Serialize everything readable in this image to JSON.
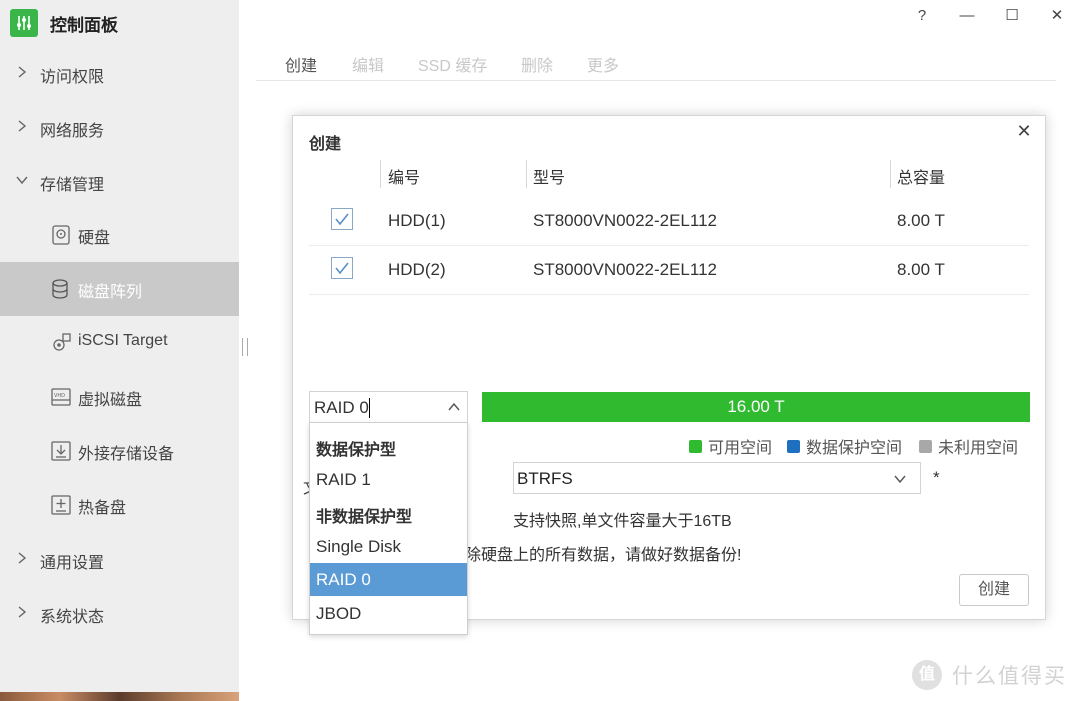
{
  "app": {
    "title": "控制面板"
  },
  "sidebar": {
    "nav": [
      {
        "label": "访问权限"
      },
      {
        "label": "网络服务"
      },
      {
        "label": "存储管理"
      },
      {
        "label": "通用设置"
      },
      {
        "label": "系统状态"
      }
    ],
    "storage_sub": [
      {
        "label": "硬盘",
        "icon": "disk-icon"
      },
      {
        "label": "磁盘阵列",
        "icon": "disk-array-icon"
      },
      {
        "label": "iSCSI Target",
        "icon": "iscsi-icon"
      },
      {
        "label": "虚拟磁盘",
        "icon": "virtual-disk-icon"
      },
      {
        "label": "外接存储设备",
        "icon": "external-storage-icon"
      },
      {
        "label": "热备盘",
        "icon": "hot-spare-icon"
      }
    ]
  },
  "window": {
    "help": "?",
    "minimize": "—",
    "maximize": "☐",
    "close": "✕"
  },
  "toolbar": {
    "create": "创建",
    "edit": "编辑",
    "ssd_cache": "SSD 缓存",
    "delete": "删除",
    "more": "更多"
  },
  "dialog": {
    "title": "创建",
    "close": "✕",
    "columns": {
      "number": "编号",
      "model": "型号",
      "capacity": "总容量"
    },
    "disks": [
      {
        "number": "HDD(1)",
        "model": "ST8000VN0022-2EL112",
        "capacity": "8.00 T",
        "checked": true
      },
      {
        "number": "HDD(2)",
        "model": "ST8000VN0022-2EL112",
        "capacity": "8.00 T",
        "checked": true
      }
    ],
    "raid_value": "RAID 0",
    "capacity_bar": "16.00 T",
    "legend": [
      {
        "label": "可用空间",
        "color": "#2fba2f"
      },
      {
        "label": "数据保护空间",
        "color": "#1f6fc0"
      },
      {
        "label": "未利用空间",
        "color": "#a8a8a8"
      }
    ],
    "fs_value": "BTRFS",
    "required_mark": "*",
    "fs_desc": "支持快照,单文件容量大于16TB",
    "warning": "除硬盘上的所有数据，请做好数据备份!",
    "partial_char": "文",
    "create_button": "创建"
  },
  "raid_dropdown": [
    {
      "label": "数据保护型",
      "type": "group"
    },
    {
      "label": "RAID 1",
      "type": "option"
    },
    {
      "label": "非数据保护型",
      "type": "group"
    },
    {
      "label": "Single Disk",
      "type": "option"
    },
    {
      "label": "RAID 0",
      "type": "option",
      "selected": true
    },
    {
      "label": "JBOD",
      "type": "option"
    }
  ],
  "watermark": {
    "logo": "值",
    "text": "什么值得买"
  },
  "colors": {
    "accent": "#2fba2f",
    "brand": "#3ab54a",
    "selected": "#5b9bd5",
    "sidebar_active": "#c9c9c9"
  }
}
